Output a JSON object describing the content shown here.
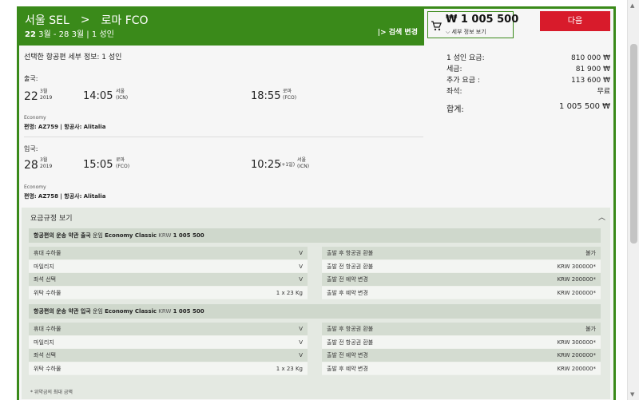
{
  "header": {
    "origin": "서울 SEL",
    "arrow": ">",
    "destination": "로마 FCO",
    "date_range": "22",
    "date_range_rest": "3월 - 28",
    "date_range_rest2": "3월 | 1 성인",
    "search_change": "|> 검색 변경"
  },
  "price_box": {
    "total": "₩ 1 005 500",
    "detail_label": "세부 정보 보기"
  },
  "next_button": "다음",
  "details": {
    "title": "선택한 항공편 세부 정보: 1 성인",
    "outbound": {
      "label": "출국:",
      "day": "22",
      "month": "3월",
      "year": "2019",
      "dep_time": "14:05",
      "dep_city": "서울",
      "dep_code": "(ICN)",
      "arr_time": "18:55",
      "arr_city": "로마",
      "arr_code": "(FCO)",
      "cabin": "Economy",
      "flight_label": "편명:",
      "flight_no": "AZ759",
      "airline_label": "| 항공사:",
      "airline": "Alitalia"
    },
    "inbound": {
      "label": "입국:",
      "day": "28",
      "month": "3월",
      "year": "2019",
      "dep_time": "15:05",
      "dep_city": "로마",
      "dep_code": "(FCO)",
      "arr_time": "10:25",
      "arr_plus": "(+1일)",
      "arr_city": "서울",
      "arr_code": "(ICN)",
      "cabin": "Economy",
      "flight_label": "편명:",
      "flight_no": "AZ758",
      "airline_label": "| 항공사:",
      "airline": "Alitalia"
    }
  },
  "summary": {
    "rows": [
      {
        "label": "1 성인 요금:",
        "value": "810 000 ₩"
      },
      {
        "label": "세금:",
        "value": "81 900 ₩"
      },
      {
        "label": "추가 요금 :",
        "value": "113 600 ₩"
      },
      {
        "label": "좌석:",
        "value": "무료"
      }
    ],
    "total_label": "합계:",
    "total_value": "1 005 500 ₩"
  },
  "fare_rules": {
    "title": "요금규정 보기",
    "blocks": [
      {
        "head_pre": "항공편의 운송 약관 출국",
        "head_mid": "운임",
        "head_class": "Economy Classic",
        "head_krw": "KRW",
        "head_amount": "1 005 500",
        "left": [
          {
            "label": "휴대 수하물",
            "value": "V"
          },
          {
            "label": "마일리지",
            "value": "V"
          },
          {
            "label": "좌석 선택",
            "value": "V"
          },
          {
            "label": "위탁 수하물",
            "value": "1 x 23 Kg"
          }
        ],
        "right": [
          {
            "label": "출발 후 항공권 환불",
            "value": "불가"
          },
          {
            "label": "출발 전 항공권 환불",
            "value": "KRW 300000*"
          },
          {
            "label": "출발 전 예약 변경",
            "value": "KRW 200000*"
          },
          {
            "label": "출발 후 예약 변경",
            "value": "KRW 200000*"
          }
        ]
      },
      {
        "head_pre": "항공편의 운송 약관 입국",
        "head_mid": "운임",
        "head_class": "Economy Classic",
        "head_krw": "KRW",
        "head_amount": "1 005 500",
        "left": [
          {
            "label": "휴대 수하물",
            "value": "V"
          },
          {
            "label": "마일리지",
            "value": "V"
          },
          {
            "label": "좌석 선택",
            "value": "V"
          },
          {
            "label": "위탁 수하물",
            "value": "1 x 23 Kg"
          }
        ],
        "right": [
          {
            "label": "출발 후 항공권 환불",
            "value": "불가"
          },
          {
            "label": "출발 전 항공권 환불",
            "value": "KRW 300000*"
          },
          {
            "label": "출발 전 예약 변경",
            "value": "KRW 200000*"
          },
          {
            "label": "출발 후 예약 변경",
            "value": "KRW 200000*"
          }
        ]
      }
    ],
    "footnote": "* 위약금의 최대 금액"
  },
  "colors": {
    "brand_green": "#3a8a1a",
    "next_red": "#d81b2b"
  }
}
